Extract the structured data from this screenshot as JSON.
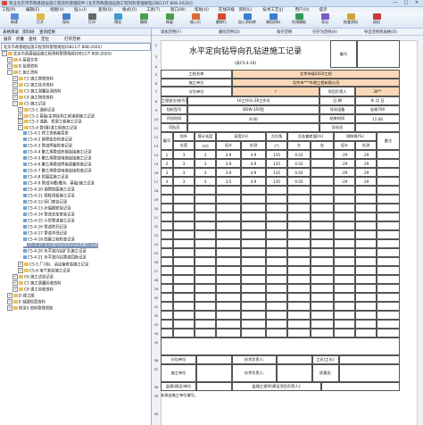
{
  "window": {
    "title": "筑业北京市市政基础设施工程资料管理软件 [北京市政基础设施工程资料管理规程(DB11/T 808-2020)]",
    "controls": [
      "—",
      "□",
      "✕"
    ]
  },
  "menu": [
    "工程(P)",
    "编辑(E)",
    "视图(V)",
    "插入(I)",
    "查询(Q)",
    "格式(O)",
    "工具(T)",
    "窗口(W)",
    "帮助(H)",
    "在线升级",
    "资料(L)",
    "技术工艺(J)",
    "用户(U)",
    "提示"
  ],
  "toolbar": {
    "buttons": [
      {
        "label": "新建",
        "color": "#5b8ed6"
      },
      {
        "label": "打开",
        "color": "#e0b64a"
      },
      {
        "label": "保存",
        "color": "#4a7fc9"
      },
      {
        "label": "打印",
        "color": "#666666"
      },
      {
        "label": "预览",
        "color": "#3d9bd1"
      },
      {
        "label": "撤销",
        "color": "#4aa04a"
      },
      {
        "label": "恢复",
        "color": "#4aa04a"
      },
      {
        "label": "插入行",
        "color": "#d96a3a"
      },
      {
        "label": "删除行",
        "color": "#d64a2f"
      },
      {
        "label": "加入资料库",
        "color": "#3b7ed0"
      },
      {
        "label": "调用资料",
        "color": "#3b7ed0"
      },
      {
        "label": "在线模板",
        "color": "#2f9a5a"
      },
      {
        "label": "导出",
        "color": "#7a5ac9"
      },
      {
        "label": "检查资料",
        "color": "#d0a33b"
      },
      {
        "label": "退出",
        "color": "#c93b3b"
      }
    ]
  },
  "left": {
    "tabs": [
      "表格目录",
      "资料树",
      "查询结果"
    ],
    "tools": [
      "展开",
      "折叠",
      "查找",
      "定位",
      "打开范例"
    ],
    "select_value": "北京市政基础设施工程资料管理规程(DB11/T 808-2020)",
    "tree": [
      {
        "label": "北京市政基础设施工程资料管理规程(DB11/T 808-2020)",
        "kind": "folder",
        "toggle": "−"
      },
      {
        "label": "A 基建文件",
        "kind": "folder",
        "toggle": "+"
      },
      {
        "label": "B 监理资料",
        "kind": "folder",
        "toggle": "+"
      },
      {
        "label": "C 施工资料",
        "kind": "folder",
        "toggle": "−"
      },
      {
        "label": "C1 施工管理资料",
        "kind": "folder",
        "toggle": "+"
      },
      {
        "label": "C2 施工技术资料",
        "kind": "folder",
        "toggle": "+"
      },
      {
        "label": "C3 施工测量监测资料",
        "kind": "folder",
        "toggle": "+"
      },
      {
        "label": "C4 施工物资资料",
        "kind": "folder",
        "toggle": "+"
      },
      {
        "label": "C5 施工记录",
        "kind": "folder",
        "toggle": "−"
      },
      {
        "label": "C5-1 通用记录",
        "kind": "folder",
        "toggle": "+"
      },
      {
        "label": "C5-2 基础/主体结构工程通用施工记录",
        "kind": "folder",
        "toggle": "+"
      },
      {
        "label": "C5-3 道路、桥梁工程施工记录",
        "kind": "folder",
        "toggle": "+"
      },
      {
        "label": "C5-4 管(隧)道工程施工记录",
        "kind": "folder",
        "toggle": "−"
      },
      {
        "label": "C5-4-1 焊工资格备案表",
        "kind": "doc"
      },
      {
        "label": "C5-4-2 钢管变形检查记录",
        "kind": "doc"
      },
      {
        "label": "C5-4-3 管道焊接检查记录",
        "kind": "doc"
      },
      {
        "label": "C5-4-4 聚乙烯管道热熔连接施工记录",
        "kind": "doc"
      },
      {
        "label": "C5-4-5 聚乙烯管道电熔连接施工记录",
        "kind": "doc"
      },
      {
        "label": "C5-4-6 聚乙烯管道焊接质量检查记录",
        "kind": "doc"
      },
      {
        "label": "C5-4-7 聚乙烯管道电熔连接检查记录",
        "kind": "doc"
      },
      {
        "label": "C5-4-8 防腐层施工记录",
        "kind": "doc"
      },
      {
        "label": "C5-4-9 管道沟槽(槽沟、基础)施工记录",
        "kind": "doc"
      },
      {
        "label": "C5-4-10 钢管防腐施工记录",
        "kind": "doc"
      },
      {
        "label": "C5-4-11 牺牲阳极施工记录",
        "kind": "doc"
      },
      {
        "label": "C5-4-12 阀门安装记录",
        "kind": "doc"
      },
      {
        "label": "C5-4-13 补偿器安装记录",
        "kind": "doc"
      },
      {
        "label": "C5-4-14 管道支架安装记录",
        "kind": "doc"
      },
      {
        "label": "C5-4-15 小型管道施工记录",
        "kind": "doc"
      },
      {
        "label": "C5-4-16 管道吹扫记录",
        "kind": "doc"
      },
      {
        "label": "C5-4-17 管道冲洗记录",
        "kind": "doc"
      },
      {
        "label": "C5-4-18 隐蔽工程检查记录",
        "kind": "doc"
      },
      {
        "label": "C5-4-19 水平定向钻导向孔钻进施工记录",
        "kind": "doc",
        "selected": true
      },
      {
        "label": "C5-4-20 水平定向钻扩孔施工记录",
        "kind": "doc"
      },
      {
        "label": "C5-4-21 水平定向钻管道回拖记录",
        "kind": "doc"
      },
      {
        "label": "C5-5 厂(场)、站设备安装施工记录",
        "kind": "folder",
        "toggle": "+"
      },
      {
        "label": "C5-6 电气安装施工记录",
        "kind": "folder",
        "toggle": "+"
      },
      {
        "label": "C6 施工试验记录",
        "kind": "folder",
        "toggle": "+"
      },
      {
        "label": "C7 施工质量验收资料",
        "kind": "folder",
        "toggle": "+"
      },
      {
        "label": "C8 竣工验收资料",
        "kind": "folder",
        "toggle": "+"
      },
      {
        "label": "D 竣工图",
        "kind": "folder",
        "toggle": "+"
      },
      {
        "label": "E 城建档案资料",
        "kind": "folder",
        "toggle": "+"
      },
      {
        "label": "附录5 资料管理须知",
        "kind": "folder",
        "toggle": "+"
      }
    ]
  },
  "right": {
    "tools": [
      "添加范例(F)",
      "删除范例(D)",
      "保存范例",
      "另存为范例(A)",
      "导出范例到表格(O)"
    ],
    "form": {
      "title": "水平定向钻导向孔钻进施工记录",
      "subtitle": "(表C5-4-19)",
      "no_label": "编号",
      "project_name_label": "工程名称",
      "project_name": "北京市政2020工程",
      "contractor_label": "施工单位",
      "contractor": "北京市***市政工程有限公司",
      "sub_label": "分包单位",
      "sub_value": "/",
      "pipe_no_label": "管线编号",
      "pipe_no_value": "1",
      "crossing_no_label": "项目负责人",
      "crossing_no_value": "30**",
      "location_label": "工程部位(桩号)",
      "location_value": "16工作坑-28工作坑",
      "date_label": "日 期",
      "date_value": "年   月   日",
      "rig_label": "钻机型号",
      "rig_value": "DDW-350型",
      "guide_label": "导向设备",
      "guide_value": "金刚700",
      "start_label": "开钻时间",
      "start_value": "8:00",
      "end_label": "结束时间",
      "end_value": "11:00",
      "driller_label": "司钻员",
      "tracker_label": "导向员",
      "headers": {
        "no": "编号",
        "rod": "钻杆",
        "rod_len": "长度",
        "rod_len_unit": "(m)",
        "depth_calc": "管计长度",
        "depth_calc2": "(m)",
        "depth": "深度(m)",
        "design": "设计",
        "actual": "实测",
        "pitch": "方位角",
        "pitch_unit": "(°)",
        "left_right": "左右偏差值(m)",
        "left": "左",
        "right": "右",
        "slope": "倾斜角(%)",
        "slope_design": "设计",
        "slope_actual": "实测",
        "note": "备注"
      },
      "rows": [
        [
          "1",
          "3",
          "3",
          "3.9",
          "4.9",
          "135",
          "0.02",
          "",
          "-29",
          "-29",
          ""
        ],
        [
          "2",
          "3",
          "3",
          "3.9",
          "4.9",
          "135",
          "0.02",
          "",
          "-29",
          "-29",
          ""
        ],
        [
          "3",
          "3",
          "3",
          "3.9",
          "4.9",
          "135",
          "0.02",
          "",
          "-29",
          "-29",
          ""
        ],
        [
          "4",
          "3",
          "3",
          "3.5",
          "4.9",
          "135",
          "0.02",
          "",
          "-29",
          "-29",
          ""
        ]
      ],
      "sign_sub": "分包单位",
      "sign_tech": "技术负责人:",
      "sign_quality": "质量员:",
      "sign_foreman": "工长(工长):",
      "sign_contractor": "施工单位",
      "sign_supervise": "监理(建设)单位",
      "sign_engineer": "监理工程师(建设项目负责人):",
      "footer": "本表由施工单位填写。"
    }
  }
}
